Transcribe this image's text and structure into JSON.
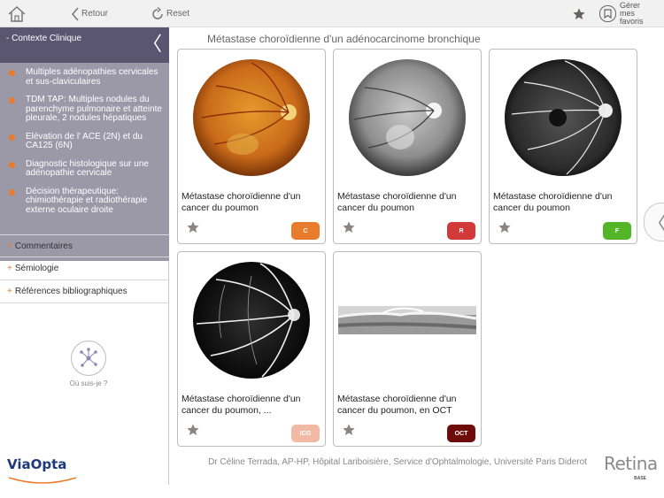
{
  "topbar": {
    "back_label": "Retour",
    "reset_label": "Reset",
    "manage_label": "Gérer mes favoris"
  },
  "sidebar": {
    "clinical_header": "- Contexte Clinique",
    "clinical_items": [
      "Multiples adénopathies cervicales et sus-claviculaires",
      "TDM TAP: Multiples nodules du parenchyme pulmonaire et atteinte pleurale, 2 nodules hépatiques",
      "Elévation de l' ACE (2N) et du CA125 (6N)",
      "Diagnostic histologique sur une adénopathie cervicale",
      "Décision thérapeutique: chimiothérapie et radiothérapie externe oculaire droite"
    ],
    "accordions": [
      "Commentaires",
      "Sémiologie",
      "Références bibliographiques"
    ],
    "where_label": "Où suis-je ?",
    "logo": "ViaOpta"
  },
  "main": {
    "title": "Métastase choroïdienne d'un adénocarcinome bronchique",
    "cards": [
      {
        "caption": "Métastase choroïdienne d'un cancer du poumon",
        "badge": "C",
        "badge_color": "#e97b2d",
        "image": "color-fundus"
      },
      {
        "caption": "Métastase choroïdienne d'un cancer du poumon",
        "badge": "R",
        "badge_color": "#d23a3a",
        "image": "red-free-fundus"
      },
      {
        "caption": "Métastase choroïdienne d'un cancer du poumon",
        "badge": "F",
        "badge_color": "#55b528",
        "image": "fluorescein-angiogram"
      },
      {
        "caption": "Métastase choroïdienne d'un cancer du poumon, ...",
        "badge": "ICG",
        "badge_color": "#f2b9a4",
        "image": "icg-angiogram"
      },
      {
        "caption": "Métastase choroïdienne d'un cancer du poumon, en OCT",
        "badge": "OCT",
        "badge_color": "#6e0c0c",
        "image": "oct-scan"
      }
    ],
    "credit": "Dr Céline Terrada, AP-HP, Hôpital Lariboisière, Service d'Ophtalmologie, Université Paris Diderot",
    "brand": "Retina",
    "brand_sub": "BASE"
  }
}
